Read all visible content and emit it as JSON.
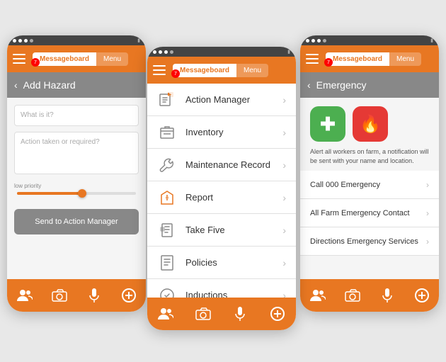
{
  "scene": {
    "background": "#e8e8e8"
  },
  "left_phone": {
    "status_bar": {
      "dots": 4,
      "battery": "▮"
    },
    "nav": {
      "messageboard_label": "Messageboard",
      "menu_label": "Menu",
      "badge": "7"
    },
    "header": {
      "back": "<",
      "title": "Add Hazard"
    },
    "form": {
      "field1_placeholder": "What is it?",
      "field2_placeholder": "Action taken or required?",
      "slider_label": "low priority",
      "slider_value": 55,
      "send_button_label": "Send to Action Manager"
    },
    "tabs": {
      "icons": [
        "👥",
        "📷",
        "🎤",
        "➕"
      ]
    }
  },
  "center_phone": {
    "status_bar": {
      "dots": 4,
      "battery": "▮"
    },
    "nav": {
      "messageboard_label": "Messageboard",
      "menu_label": "Menu",
      "badge": "7"
    },
    "menu_items": [
      {
        "id": "action-manager",
        "label": "Action Manager",
        "icon": "action"
      },
      {
        "id": "inventory",
        "label": "Inventory",
        "icon": "inventory"
      },
      {
        "id": "maintenance",
        "label": "Maintenance Record",
        "icon": "maintenance"
      },
      {
        "id": "report",
        "label": "Report",
        "icon": "report"
      },
      {
        "id": "take-five",
        "label": "Take Five",
        "icon": "takefive"
      },
      {
        "id": "policies",
        "label": "Policies",
        "icon": "policies"
      },
      {
        "id": "inductions",
        "label": "Inductions",
        "icon": "inductions"
      }
    ],
    "tabs": {
      "icons": [
        "👥",
        "📷",
        "🎤",
        "➕"
      ]
    }
  },
  "right_phone": {
    "status_bar": {
      "dots": 4,
      "battery": "▮"
    },
    "nav": {
      "messageboard_label": "Messageboard",
      "menu_label": "Menu",
      "badge": "7"
    },
    "header": {
      "back": "<",
      "title": "Emergency"
    },
    "icons": [
      {
        "id": "medical",
        "symbol": "✚",
        "color_class": "emerg-icon-green"
      },
      {
        "id": "fire",
        "symbol": "🔥",
        "color_class": "emerg-icon-red"
      }
    ],
    "alert_text": "Alert all workers on farm, a notification will be sent with your name and location.",
    "list_items": [
      {
        "id": "call-000",
        "label": "Call 000 Emergency"
      },
      {
        "id": "farm-contact",
        "label": "All Farm Emergency Contact"
      },
      {
        "id": "directions",
        "label": "Directions Emergency Services"
      }
    ],
    "tabs": {
      "icons": [
        "👥",
        "📷",
        "🎤",
        "➕"
      ]
    }
  }
}
